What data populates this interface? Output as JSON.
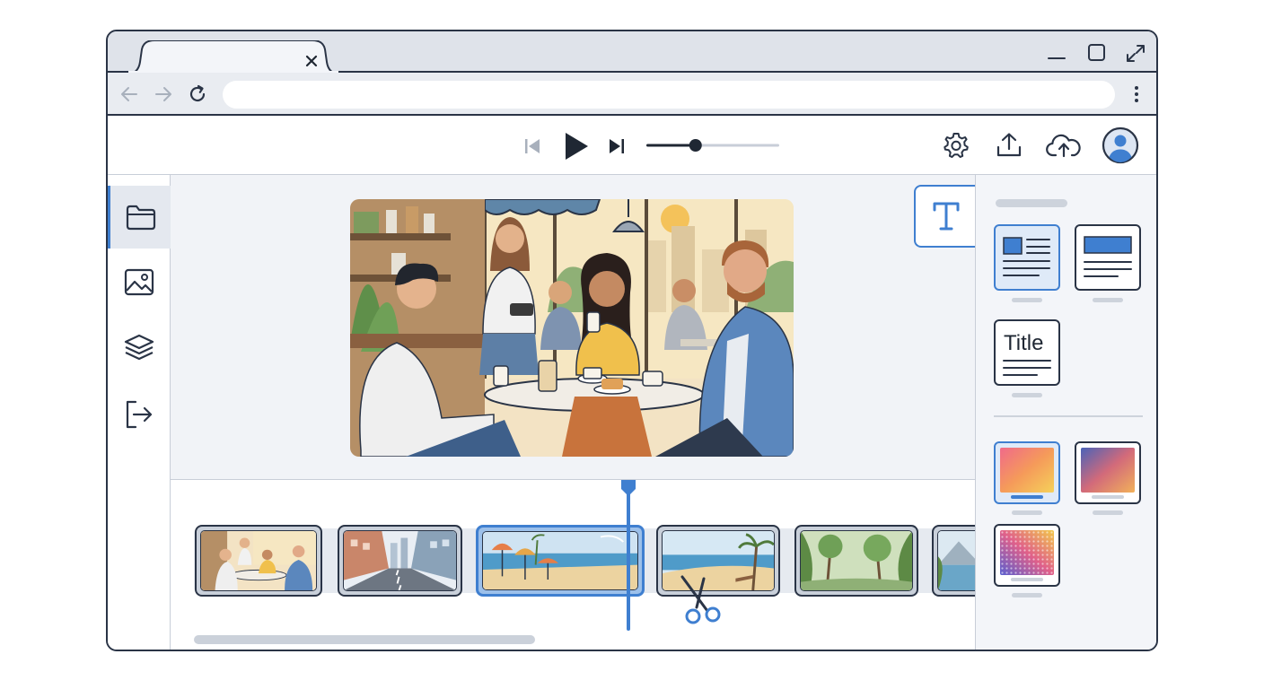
{
  "browser": {
    "tab": {
      "title": "",
      "close_icon": "close-icon"
    },
    "window_controls": [
      "minimize-icon",
      "maximize-icon",
      "fullscreen-icon"
    ],
    "nav": [
      "back-arrow-icon",
      "forward-arrow-icon",
      "reload-icon"
    ],
    "address": {
      "value": "",
      "placeholder": ""
    },
    "menu_icon": "kebab-menu-icon"
  },
  "toolbar": {
    "playback": [
      "skip-back-icon",
      "play-icon",
      "skip-forward-icon"
    ],
    "progress": 0.37,
    "actions": [
      "gear-icon",
      "share-upload-icon",
      "cloud-upload-icon",
      "user-avatar-icon"
    ]
  },
  "sidebar": {
    "items": [
      {
        "icon": "folder-icon",
        "active": true
      },
      {
        "icon": "image-icon",
        "active": false
      },
      {
        "icon": "layers-icon",
        "active": false
      },
      {
        "icon": "exit-icon",
        "active": false
      }
    ]
  },
  "preview": {
    "scene": "cafe"
  },
  "text_tool": {
    "icon": "text-icon"
  },
  "timeline": {
    "clips": [
      {
        "scene": "cafe",
        "selected": false
      },
      {
        "scene": "city-street",
        "selected": false
      },
      {
        "scene": "beach-umbrellas",
        "selected": true
      },
      {
        "scene": "beach-palms",
        "selected": false
      },
      {
        "scene": "jungle",
        "selected": false
      },
      {
        "scene": "mountain-lake",
        "selected": false
      }
    ],
    "tool_icon": "scissors-icon"
  },
  "right_panel": {
    "layouts": [
      {
        "kind": "image-left-text",
        "selected": true
      },
      {
        "kind": "banner-text",
        "selected": false
      },
      {
        "kind": "title-text",
        "selected": false,
        "label": "Title"
      }
    ],
    "styles": [
      {
        "kind": "gradient-sunset",
        "selected": true
      },
      {
        "kind": "gradient-dusk",
        "selected": false
      },
      {
        "kind": "halftone-gradient",
        "selected": false
      }
    ]
  },
  "colors": {
    "accent": "#3f7fd0",
    "outline": "#2a3446",
    "chrome": "#dfe3ea"
  }
}
